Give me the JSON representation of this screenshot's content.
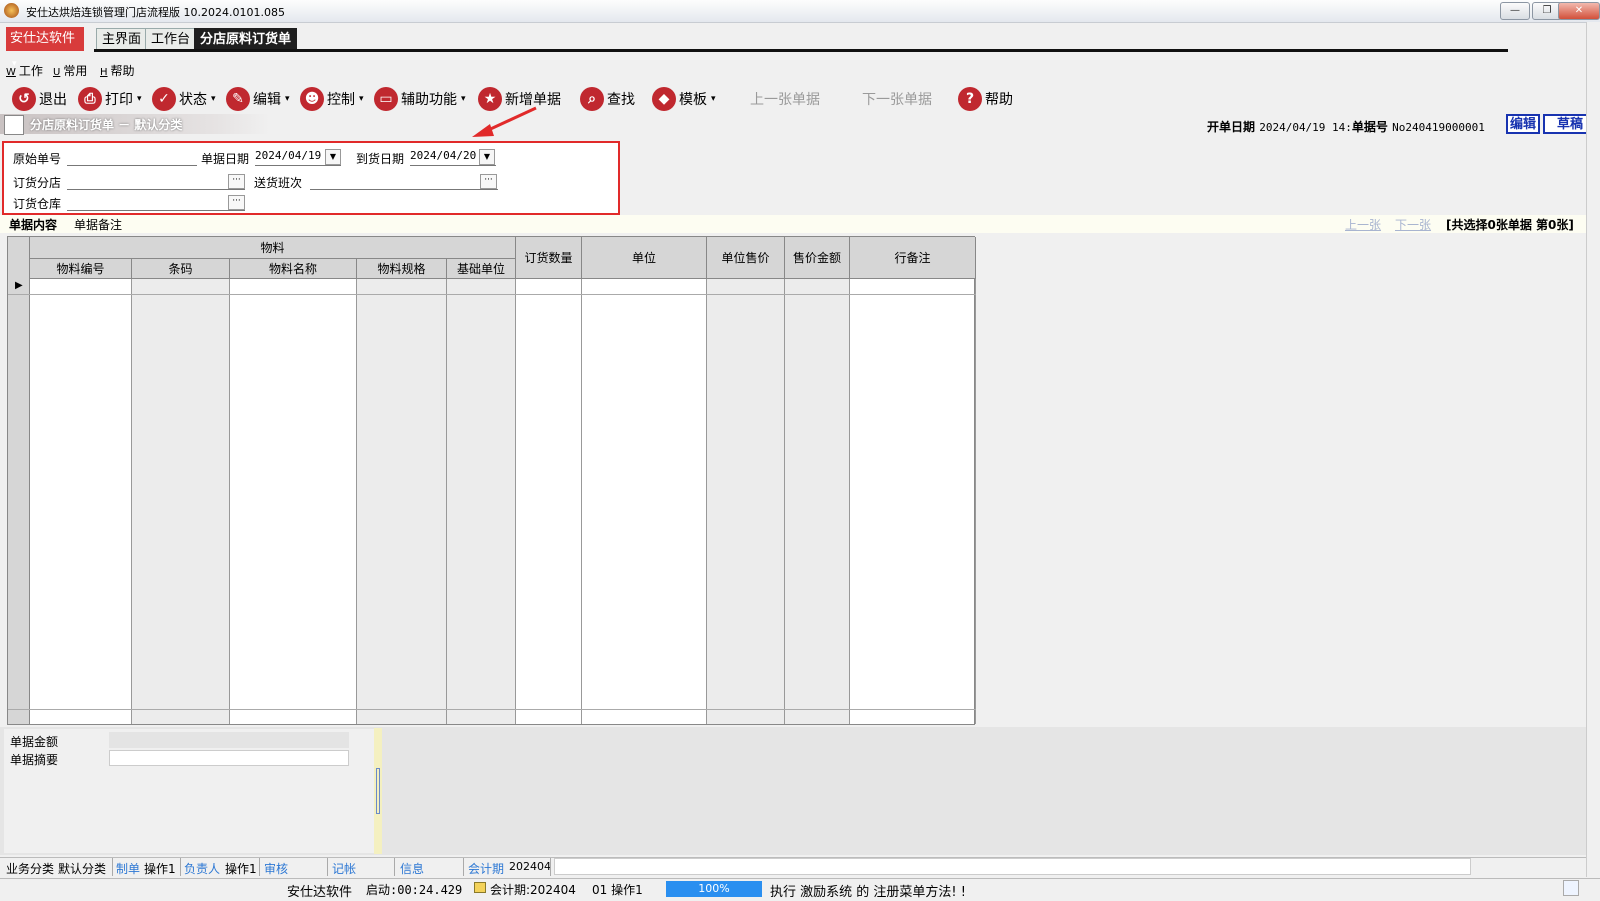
{
  "window": {
    "title": "安仕达烘焙连锁管理门店流程版   10.2024.0101.085",
    "minimize": "—",
    "restore": "❐",
    "close": "✕"
  },
  "brand": {
    "label": "安仕达软件",
    "caret": "▾"
  },
  "top_tabs": [
    {
      "label": "主界面"
    },
    {
      "label": "工作台"
    },
    {
      "label": "分店原料订货单"
    }
  ],
  "menu": [
    {
      "key": "W",
      "label": "工作"
    },
    {
      "key": "U",
      "label": "常用"
    },
    {
      "key": "H",
      "label": "帮助"
    }
  ],
  "toolbar": [
    {
      "label": "退出",
      "icon": "exit-icon",
      "glyph": "↺",
      "caret": ""
    },
    {
      "label": "打印",
      "icon": "print-icon",
      "glyph": "⎙",
      "caret": "▾"
    },
    {
      "label": "状态",
      "icon": "check-icon",
      "glyph": "✓",
      "caret": "▾"
    },
    {
      "label": "编辑",
      "icon": "pencil-icon",
      "glyph": "✎",
      "caret": "▾"
    },
    {
      "label": "控制",
      "icon": "user-icon",
      "glyph": "☻",
      "caret": "▾"
    },
    {
      "label": "辅助功能",
      "icon": "folder-icon",
      "glyph": "▭",
      "caret": "▾"
    },
    {
      "label": "新增单据",
      "icon": "star-icon",
      "glyph": "★",
      "caret": ""
    },
    {
      "label": "查找",
      "icon": "search-icon",
      "glyph": "⌕",
      "caret": ""
    },
    {
      "label": "模板",
      "icon": "eraser-icon",
      "glyph": "◆",
      "caret": "▾"
    },
    {
      "label": "上一张单据",
      "icon": "",
      "glyph": "",
      "caret": ""
    },
    {
      "label": "下一张单据",
      "icon": "",
      "glyph": "",
      "caret": ""
    },
    {
      "label": "帮助",
      "icon": "help-icon",
      "glyph": "?",
      "caret": ""
    }
  ],
  "doc_header": {
    "title": "分店原料订货单 － 默认分类",
    "open_date_label": "开单日期",
    "open_date_value": "2024/04/19 14:",
    "doc_no_label": "单据号",
    "doc_no_value": "No240419000001",
    "edit_button": "编辑",
    "draft_button": "草稿"
  },
  "form": {
    "orig_no_label": "原始单号",
    "orig_no_value": "",
    "doc_date_label": "单据日期",
    "doc_date_value": "2024/04/19",
    "arrival_date_label": "到货日期",
    "arrival_date_value": "2024/04/20",
    "branch_label": "订货分店",
    "branch_value": "",
    "shift_label": "送货班次",
    "shift_value": "",
    "warehouse_label": "订货仓库",
    "warehouse_value": "",
    "dots": "···",
    "dd": "▼"
  },
  "sub_tabs": [
    {
      "label": "单据内容"
    },
    {
      "label": "单据备注"
    }
  ],
  "nav": {
    "prev": "上一张",
    "next": "下一张",
    "selection": "[共选择0张单据  第0张]"
  },
  "grid": {
    "group_header": "物料",
    "columns": [
      "物料编号",
      "条码",
      "物料名称",
      "物料规格",
      "基础单位",
      "订货数量",
      "单位",
      "单位售价",
      "售价金额",
      "行备注"
    ]
  },
  "summary": {
    "amount_label": "单据金额",
    "amount_value": "",
    "abstract_label": "单据摘要",
    "abstract_value": ""
  },
  "status1": {
    "category_label": "业务分类",
    "category_value": "默认分类",
    "maker_label": "制单",
    "maker_value": "操作1",
    "owner_label": "负责人",
    "owner_value": "操作1",
    "audit_label": "审核",
    "post_label": "记帐",
    "info_label": "信息",
    "period_label": "会计期",
    "period_value": "202404"
  },
  "status2": {
    "company": "安仕达软件",
    "uptime": "启动:00:24.429",
    "period": "会计期:202404",
    "user": "01 操作1",
    "progress_text": "100%",
    "progress_value": 1.0,
    "message": "执行 激励系统 的 注册菜单方法! !"
  },
  "colors": {
    "brand_red": "#d83b3b",
    "highlight_red": "#e12a2a",
    "accent_blue": "#1833b0",
    "link_blue": "#2d78d4"
  }
}
